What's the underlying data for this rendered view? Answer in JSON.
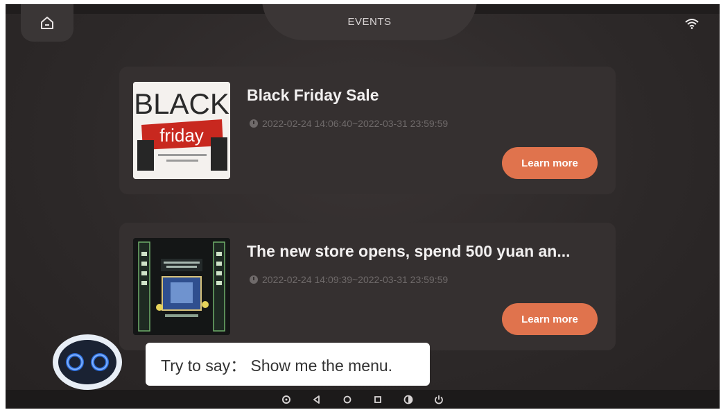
{
  "header": {
    "title": "EVENTS",
    "home_icon": "home-icon",
    "status_icon": "wifi-icon"
  },
  "events": [
    {
      "title": "Black Friday Sale",
      "time": "2022-02-24 14:06:40~2022-03-31 23:59:59",
      "button_label": "Learn more",
      "thumbnail": {
        "line1": "BLACK",
        "line2": "friday"
      }
    },
    {
      "title": "The new store opens, spend 500 yuan an...",
      "time": "2022-02-24 14:09:39~2022-03-31 23:59:59",
      "button_label": "Learn more"
    }
  ],
  "assistant": {
    "hint": "Try to say： Show me the menu."
  },
  "navbar": {
    "icons": [
      "settings-icon",
      "back-icon",
      "home-icon",
      "recents-icon",
      "volume-icon",
      "power-icon"
    ]
  },
  "colors": {
    "accent": "#e0734d",
    "background": "#2d2929",
    "card": "#353030"
  }
}
